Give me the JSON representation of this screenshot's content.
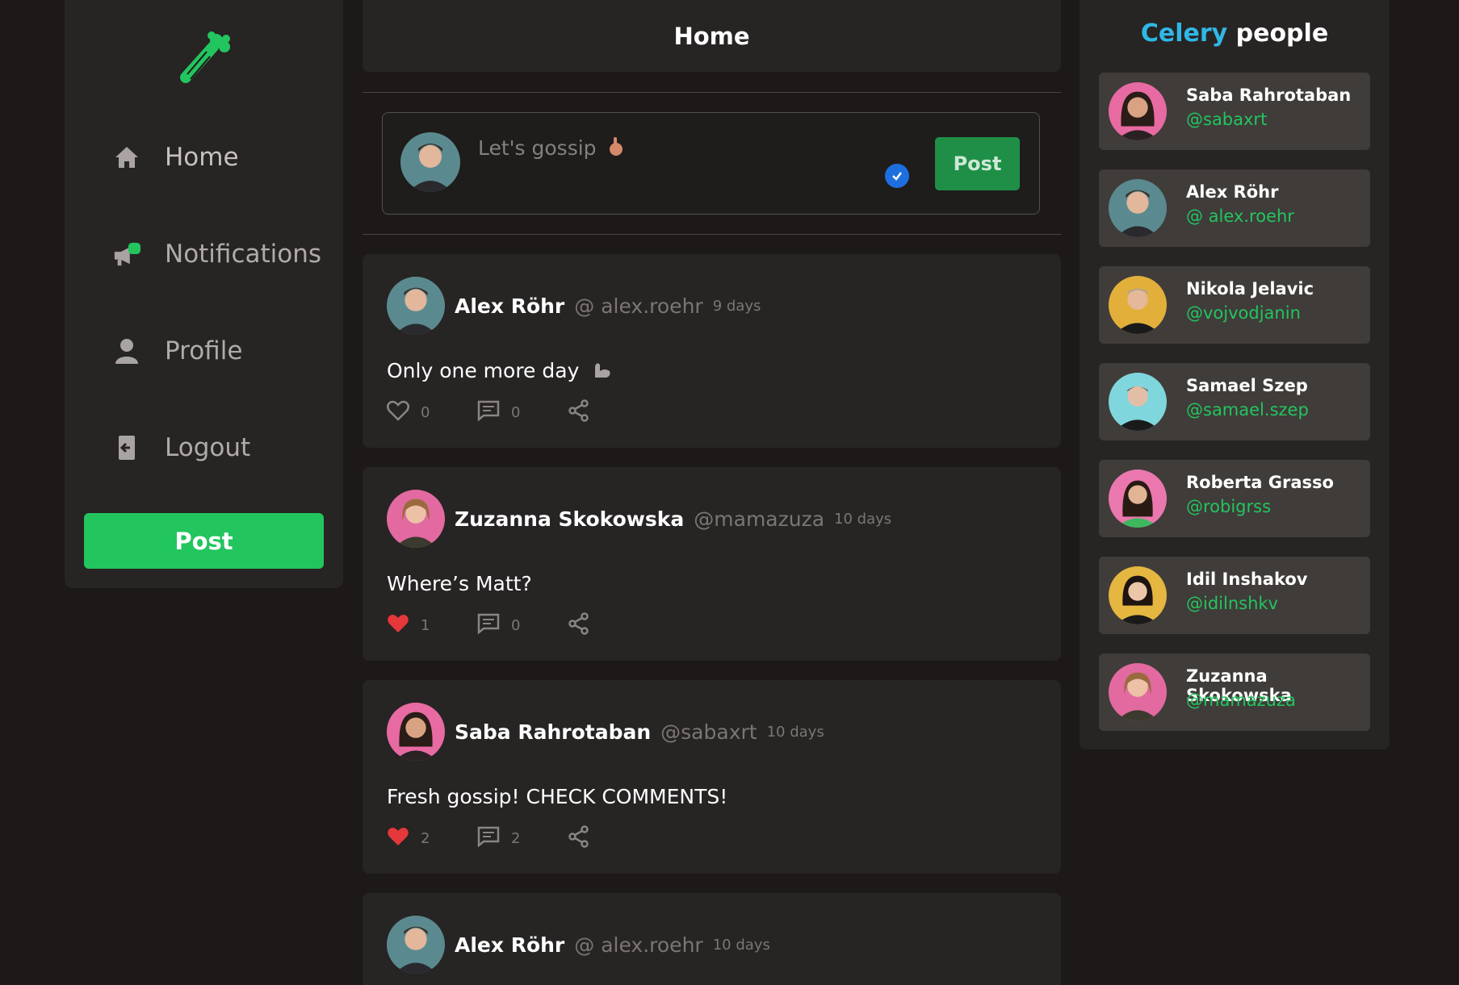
{
  "sidebar": {
    "nav": [
      {
        "label": "Home",
        "icon": "home-icon"
      },
      {
        "label": "Notifications",
        "icon": "notifications-icon"
      },
      {
        "label": "Profile",
        "icon": "profile-icon"
      },
      {
        "label": "Logout",
        "icon": "logout-icon"
      }
    ],
    "post_button": "Post",
    "logo": "celery-logo-icon"
  },
  "main": {
    "title": "Home",
    "composer": {
      "placeholder": "Let's gossip",
      "post_button": "Post"
    },
    "posts": [
      {
        "name": "Alex Röhr",
        "handle": "@ alex.roehr",
        "time": "9 days",
        "body": "Only one more day",
        "likes": "0",
        "liked": false,
        "comments": "0"
      },
      {
        "name": "Zuzanna Skokowska",
        "handle": "@mamazuza",
        "time": "10 days",
        "body": "Where’s Matt?",
        "likes": "1",
        "liked": true,
        "comments": "0"
      },
      {
        "name": "Saba Rahrotaban",
        "handle": "@sabaxrt",
        "time": "10 days",
        "body": "Fresh gossip! CHECK COMMENTS!",
        "likes": "2",
        "liked": true,
        "comments": "2"
      },
      {
        "name": "Alex Röhr",
        "handle": "@ alex.roehr",
        "time": "10 days",
        "body": "",
        "likes": "",
        "liked": false,
        "comments": ""
      }
    ]
  },
  "people": {
    "title_part1": "Celery",
    "title_part2": "people",
    "list": [
      {
        "name": "Saba Rahrotaban",
        "handle": "@sabaxrt"
      },
      {
        "name": "Alex Röhr",
        "handle": "@ alex.roehr"
      },
      {
        "name": "Nikola Jelavic",
        "handle": "@vojvodjanin"
      },
      {
        "name": "Samael Szep",
        "handle": "@samael.szep"
      },
      {
        "name": "Roberta Grasso",
        "handle": "@robigrss"
      },
      {
        "name": "Idil Inshakov",
        "handle": "@idilnshkv"
      },
      {
        "name": "Zuzanna Skokowska",
        "handle": "@mamazuza"
      }
    ]
  },
  "colors": {
    "accent_green": "#22c55e",
    "accent_blue": "#2fb8e6",
    "like_red": "#e5383b",
    "background": "#1c1918",
    "panel": "#272424"
  }
}
